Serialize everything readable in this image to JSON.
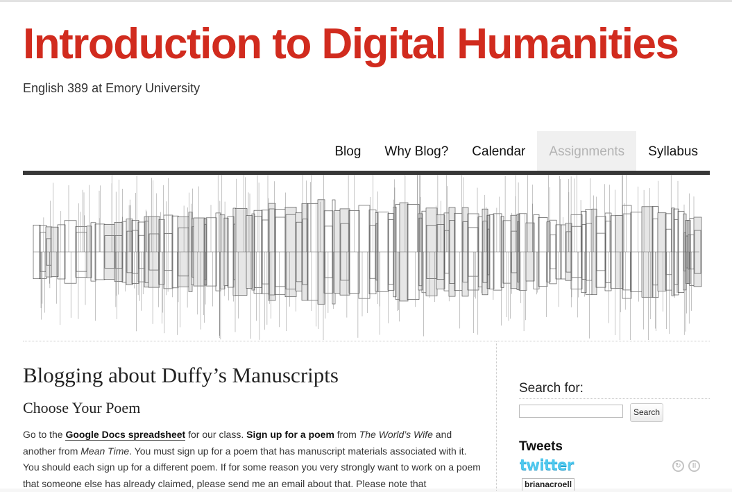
{
  "site": {
    "title": "Introduction to Digital Humanities",
    "description": "English 389 at Emory University",
    "title_color": "#d12b1e"
  },
  "nav": {
    "items": [
      {
        "label": "Blog",
        "current": false
      },
      {
        "label": "Why Blog?",
        "current": false
      },
      {
        "label": "Calendar",
        "current": false
      },
      {
        "label": "Assignments",
        "current": true
      },
      {
        "label": "Syllabus",
        "current": false
      }
    ]
  },
  "post": {
    "title": "Blogging about Duffy’s Manuscripts",
    "subtitle": "Choose Your Poem",
    "p1_a": "Go to the ",
    "link_spreadsheet": "Google Docs spreadsheet",
    "p1_b": " for our class. ",
    "signup": "Sign up for a poem",
    "p1_c": " from ",
    "book1": "The World’s Wife",
    "p1_d": " and another from ",
    "book2": "Mean Time",
    "p1_e": ". You must sign up for a poem that has manuscript materials associated with it. You should each sign up for a different poem. If for some reason you very strongly want to work on a poem that someone else has already claimed, please send me an email about that. Please note that"
  },
  "sidebar": {
    "search_label": "Search for:",
    "search_value": "",
    "search_button": "Search",
    "tweets_title": "Tweets",
    "twitter_logo": "twitter",
    "tweet_user": "brianacroell"
  },
  "icons": {
    "refresh": "refresh-icon",
    "pause": "pause-icon",
    "twitter_color": "#4fc8ee"
  }
}
